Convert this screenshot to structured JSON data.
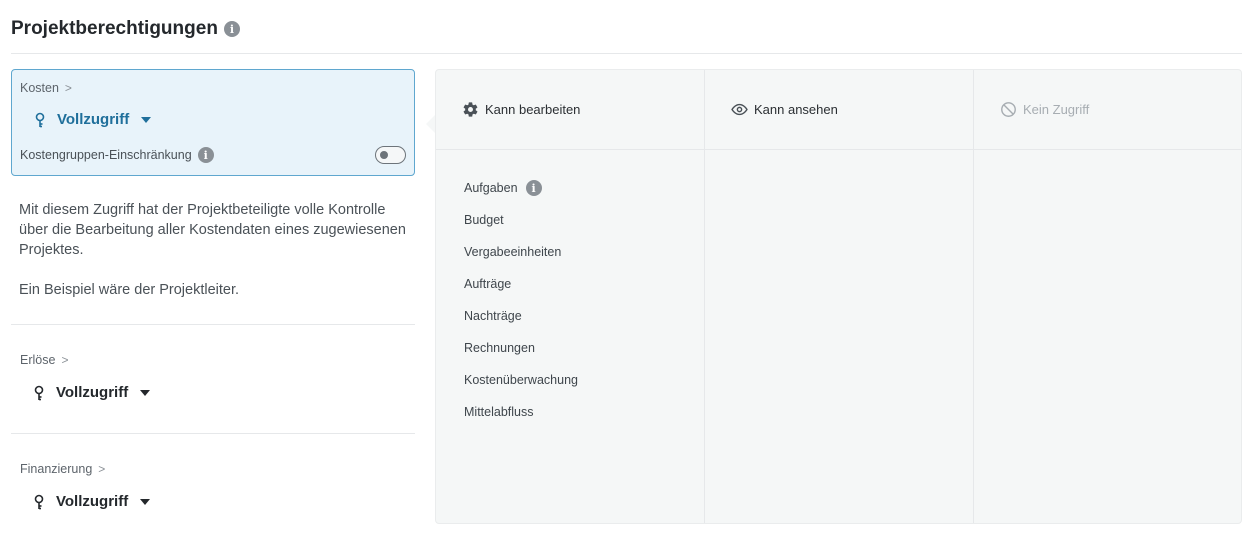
{
  "header": {
    "title": "Projektberechtigungen",
    "info_icon": "info-icon"
  },
  "cost_card": {
    "breadcrumb": "Kosten",
    "access_level": "Vollzugriff",
    "restriction_label": "Kostengruppen-Einschränkung",
    "restriction_enabled": false
  },
  "description": {
    "paragraph1": "Mit diesem Zugriff hat der Projektbeteiligte volle Kontrolle über die Bearbeitung aller Kostendaten eines zugewiesenen Projektes.",
    "paragraph2": "Ein Beispiel wäre der Projektleiter."
  },
  "sections": [
    {
      "breadcrumb": "Erlöse",
      "access_level": "Vollzugriff"
    },
    {
      "breadcrumb": "Finanzierung",
      "access_level": "Vollzugriff"
    }
  ],
  "permissions": {
    "columns": [
      {
        "label": "Kann bearbeiten",
        "icon": "gear-icon"
      },
      {
        "label": "Kann ansehen",
        "icon": "eye-icon"
      },
      {
        "label": "Kein Zugriff",
        "icon": "no-access-icon"
      }
    ],
    "editable_items": [
      "Aufgaben",
      "Budget",
      "Vergabeeinheiten",
      "Aufträge",
      "Nachträge",
      "Rechnungen",
      "Kostenüberwachung",
      "Mittelabfluss"
    ]
  },
  "colors": {
    "accent": "#1f6f9b",
    "active_bg": "#e8f3fa",
    "active_border": "#5fa7cf",
    "panel_bg": "#f5f7f7"
  }
}
